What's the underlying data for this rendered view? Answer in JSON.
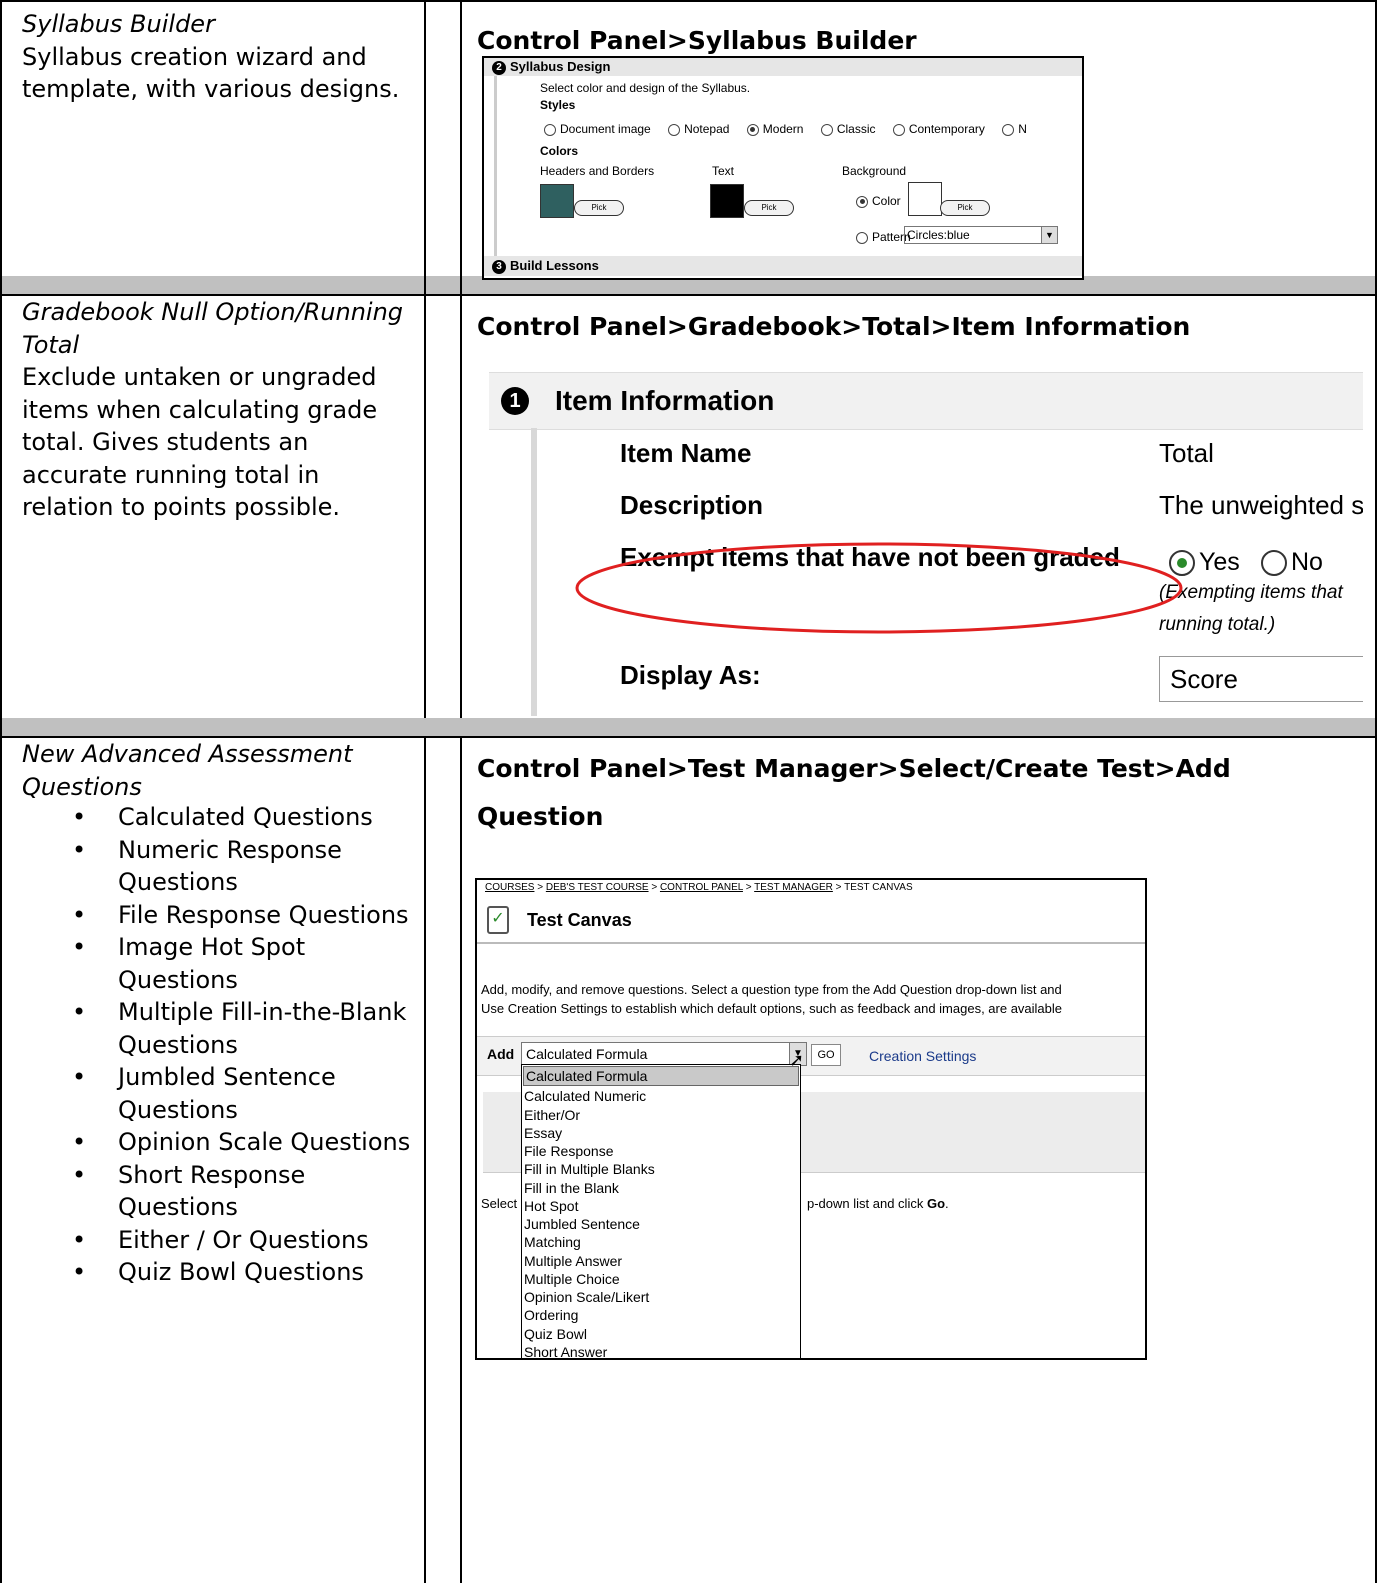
{
  "rows": [
    {
      "feature_title": "Syllabus Builder",
      "feature_desc": "Syllabus creation wizard and template, with various designs.",
      "heading": "Control Panel>Syllabus Builder"
    },
    {
      "feature_title": "Gradebook Null Option/Running Total",
      "feature_desc": "Exclude untaken or ungraded items when calculating grade total. Gives students an accurate running total in relation to points possible.",
      "heading": "Control Panel>Gradebook>Total>Item Information"
    },
    {
      "feature_title": "New Advanced Assessment Questions",
      "bullets": [
        "Calculated Questions",
        "Numeric Response Questions",
        "File Response Questions",
        "Image Hot Spot Questions",
        "Multiple Fill-in-the-Blank Questions",
        "Jumbled Sentence Questions",
        "Opinion Scale Questions",
        "Short Response Questions",
        "Either / Or Questions",
        "Quiz Bowl Questions"
      ],
      "heading_line1": "Control Panel>Test Manager>Select/Create Test>Add",
      "heading_line2": "Question"
    }
  ],
  "syllabus_shot": {
    "section2_num": "2",
    "section2_title": "Syllabus Design",
    "instruction": "Select color and design of the Syllabus.",
    "styles_label": "Styles",
    "styles": [
      "Document image",
      "Notepad",
      "Modern",
      "Classic",
      "Contemporary",
      "N"
    ],
    "selected_style": "Modern",
    "colors_label": "Colors",
    "headers_label": "Headers and Borders",
    "text_label": "Text",
    "background_label": "Background",
    "pick_label": "Pick",
    "color_option": "Color",
    "pattern_option": "Pattern",
    "pattern_value": "Circles:blue",
    "section3_num": "3",
    "section3_title": "Build Lessons",
    "colors": {
      "header": "#2f6060",
      "text": "#000000",
      "background": "#ffffff"
    }
  },
  "gradebook_shot": {
    "section_num": "1",
    "section_title": "Item Information",
    "item_name_label": "Item Name",
    "item_name_value": "Total",
    "description_label": "Description",
    "description_value": "The unweighted s",
    "exempt_label": "Exempt items that have not been graded",
    "yes_label": "Yes",
    "no_label": "No",
    "note_line1": "(Exempting items that",
    "note_line2": "running total.)",
    "display_label": "Display As:",
    "display_value": "Score",
    "highlight_color": "#e02020"
  },
  "test_shot": {
    "breadcrumb": [
      "COURSES",
      "DEB'S TEST COURSE",
      "CONTROL PANEL",
      "TEST MANAGER",
      "TEST CANVAS"
    ],
    "title": "Test Canvas",
    "intro_line1": "Add, modify, and remove questions. Select a question type from the Add Question drop-down list and",
    "intro_line2": "Use Creation Settings to establish which default options, such as feedback and images, are available",
    "add_label": "Add",
    "selected_type": "Calculated Formula",
    "go_label": "GO",
    "creation_settings": "Creation Settings",
    "select_hint_prefix": "Select",
    "select_hint_suffix": "p-down list and click",
    "select_hint_bold": "Go",
    "question_types": [
      "Calculated Formula",
      "Calculated Numeric",
      "Either/Or",
      "Essay",
      "File Response",
      "Fill in Multiple Blanks",
      "Fill in the Blank",
      "Hot Spot",
      "Jumbled Sentence",
      "Matching",
      "Multiple Answer",
      "Multiple Choice",
      "Opinion Scale/Likert",
      "Ordering",
      "Quiz Bowl",
      "Short Answer"
    ]
  }
}
